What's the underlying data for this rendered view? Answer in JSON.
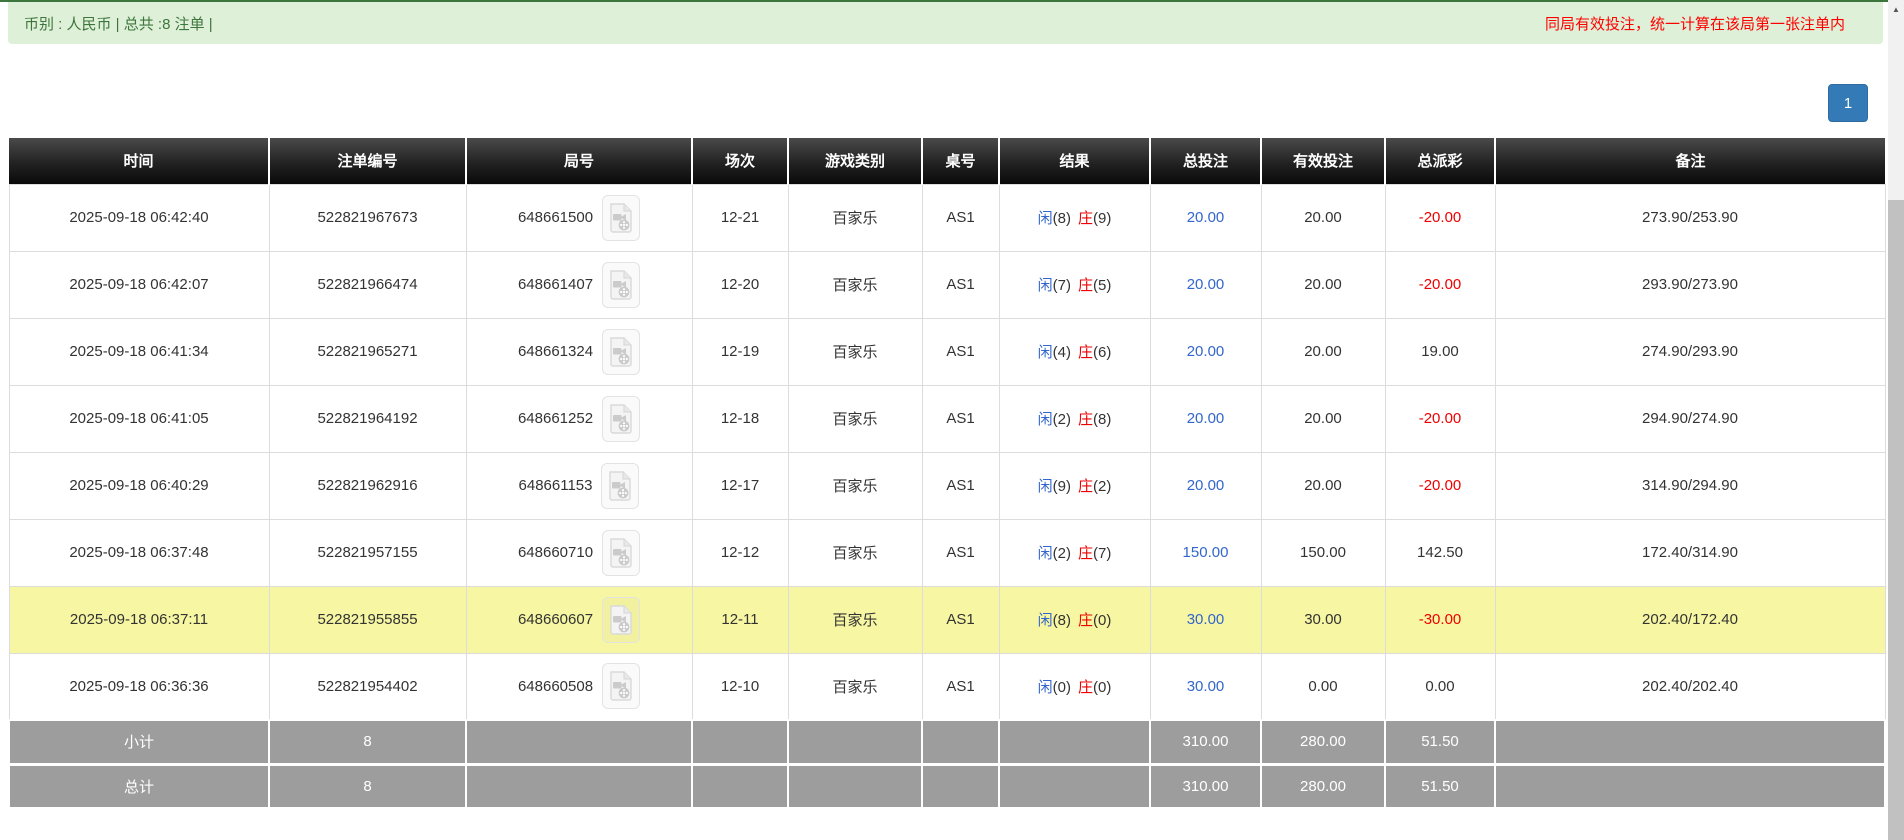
{
  "notice_bar": {
    "left_text": "币别 : 人民币 | 总共 :8 注单 |",
    "right_text": "同局有效投注，统一计算在该局第一张注单内"
  },
  "pagination": {
    "current_page": "1"
  },
  "table": {
    "columns": [
      "时间",
      "注单编号",
      "局号",
      "场次",
      "游戏类别",
      "桌号",
      "结果",
      "总投注",
      "有效投注",
      "总派彩",
      "备注"
    ],
    "rows": [
      {
        "time": "2025-09-18 06:42:40",
        "bet_no": "522821967673",
        "round_no": "648661500",
        "session": "12-21",
        "game": "百家乐",
        "table_no": "AS1",
        "player": "闲",
        "player_pts": "(8)",
        "banker": "庄",
        "banker_pts": "(9)",
        "total_bet": "20.00",
        "valid_bet": "20.00",
        "payout": "-20.00",
        "remark": "273.90/253.90",
        "highlighted": false
      },
      {
        "time": "2025-09-18 06:42:07",
        "bet_no": "522821966474",
        "round_no": "648661407",
        "session": "12-20",
        "game": "百家乐",
        "table_no": "AS1",
        "player": "闲",
        "player_pts": "(7)",
        "banker": "庄",
        "banker_pts": "(5)",
        "total_bet": "20.00",
        "valid_bet": "20.00",
        "payout": "-20.00",
        "remark": "293.90/273.90",
        "highlighted": false
      },
      {
        "time": "2025-09-18 06:41:34",
        "bet_no": "522821965271",
        "round_no": "648661324",
        "session": "12-19",
        "game": "百家乐",
        "table_no": "AS1",
        "player": "闲",
        "player_pts": "(4)",
        "banker": "庄",
        "banker_pts": "(6)",
        "total_bet": "20.00",
        "valid_bet": "20.00",
        "payout": "19.00",
        "remark": "274.90/293.90",
        "highlighted": false
      },
      {
        "time": "2025-09-18 06:41:05",
        "bet_no": "522821964192",
        "round_no": "648661252",
        "session": "12-18",
        "game": "百家乐",
        "table_no": "AS1",
        "player": "闲",
        "player_pts": "(2)",
        "banker": "庄",
        "banker_pts": "(8)",
        "total_bet": "20.00",
        "valid_bet": "20.00",
        "payout": "-20.00",
        "remark": "294.90/274.90",
        "highlighted": false
      },
      {
        "time": "2025-09-18 06:40:29",
        "bet_no": "522821962916",
        "round_no": "648661153",
        "session": "12-17",
        "game": "百家乐",
        "table_no": "AS1",
        "player": "闲",
        "player_pts": "(9)",
        "banker": "庄",
        "banker_pts": "(2)",
        "total_bet": "20.00",
        "valid_bet": "20.00",
        "payout": "-20.00",
        "remark": "314.90/294.90",
        "highlighted": false
      },
      {
        "time": "2025-09-18 06:37:48",
        "bet_no": "522821957155",
        "round_no": "648660710",
        "session": "12-12",
        "game": "百家乐",
        "table_no": "AS1",
        "player": "闲",
        "player_pts": "(2)",
        "banker": "庄",
        "banker_pts": "(7)",
        "total_bet": "150.00",
        "valid_bet": "150.00",
        "payout": "142.50",
        "remark": "172.40/314.90",
        "highlighted": false
      },
      {
        "time": "2025-09-18 06:37:11",
        "bet_no": "522821955855",
        "round_no": "648660607",
        "session": "12-11",
        "game": "百家乐",
        "table_no": "AS1",
        "player": "闲",
        "player_pts": "(8)",
        "banker": "庄",
        "banker_pts": "(0)",
        "total_bet": "30.00",
        "valid_bet": "30.00",
        "payout": "-30.00",
        "remark": "202.40/172.40",
        "highlighted": true
      },
      {
        "time": "2025-09-18 06:36:36",
        "bet_no": "522821954402",
        "round_no": "648660508",
        "session": "12-10",
        "game": "百家乐",
        "table_no": "AS1",
        "player": "闲",
        "player_pts": "(0)",
        "banker": "庄",
        "banker_pts": "(0)",
        "total_bet": "30.00",
        "valid_bet": "0.00",
        "payout": "0.00",
        "remark": "202.40/202.40",
        "highlighted": false
      }
    ],
    "subtotal": {
      "label": "小计",
      "count": "8",
      "total_bet": "310.00",
      "valid_bet": "280.00",
      "payout": "51.50"
    },
    "total": {
      "label": "总计",
      "count": "8",
      "total_bet": "310.00",
      "valid_bet": "280.00",
      "payout": "51.50"
    }
  },
  "icons": {
    "round_video": "video-file-icon",
    "scroll_up": "scroll-up-arrow"
  },
  "scrollbar": {
    "up_arrow_glyph": "▲"
  },
  "colors": {
    "success_bg": "#dff0d8",
    "success_text": "#3c763d",
    "success_line": "#3c763d",
    "notice_red": "#ff0000",
    "link_blue": "#3366cc",
    "neg_red": "#ee0000",
    "pager_blue": "#337ab7",
    "pager_border": "#2e6da4",
    "highlight_yellow": "#f7f6a3",
    "summary_gray": "#9d9d9d"
  }
}
